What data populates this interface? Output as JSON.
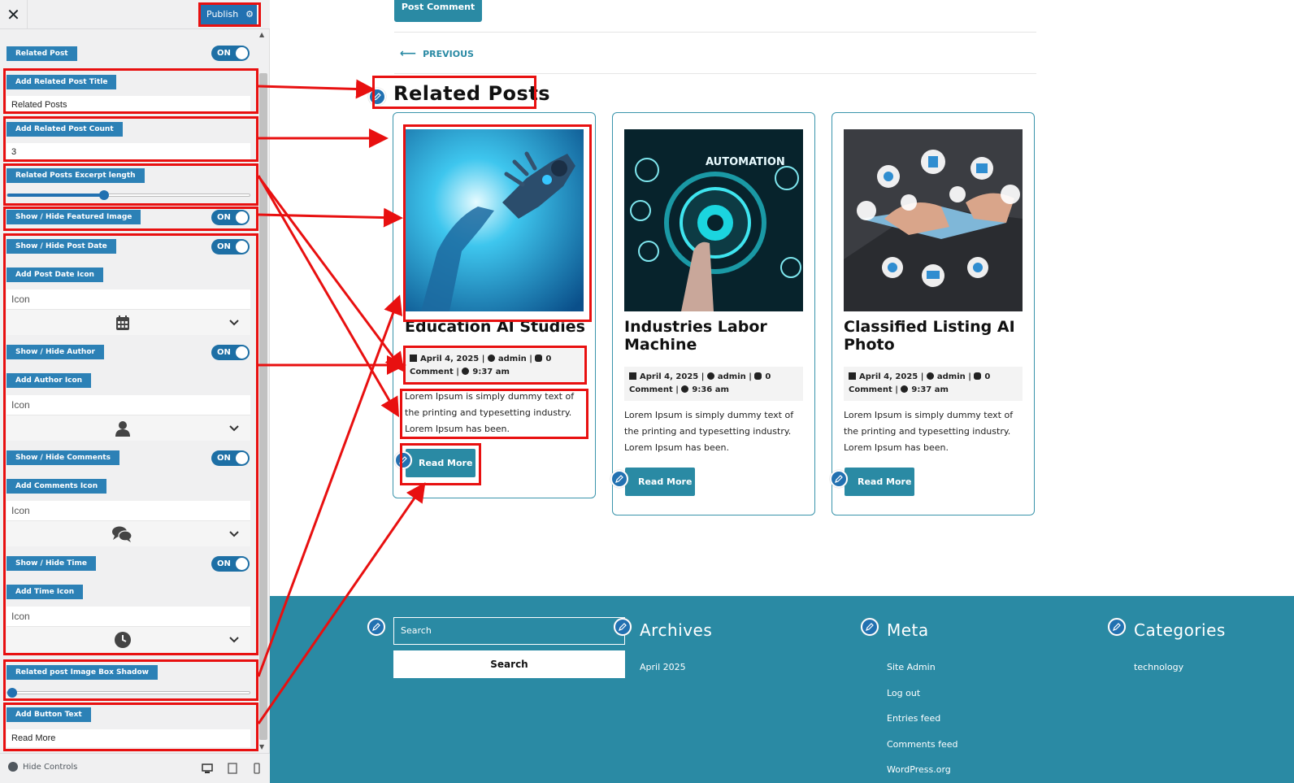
{
  "customizer": {
    "close_icon": "close-icon",
    "publish_label": "Publish",
    "hide_controls_label": "Hide Controls",
    "controls": {
      "related_post": {
        "label": "Related Post",
        "toggle": "ON"
      },
      "post_title": {
        "label": "Add Related Post Title",
        "value": "Related Posts"
      },
      "post_count": {
        "label": "Add Related Post Count",
        "value": "3"
      },
      "excerpt_length": {
        "label": "Related Posts Excerpt length",
        "value_fraction": 0.4
      },
      "featured_image": {
        "label": "Show / Hide Featured Image",
        "toggle": "ON"
      },
      "post_date": {
        "label": "Show / Hide Post Date",
        "toggle": "ON"
      },
      "date_icon": {
        "label": "Add Post Date Icon",
        "placeholder": "Icon",
        "selected_icon": "calendar-icon"
      },
      "author": {
        "label": "Show / Hide Author",
        "toggle": "ON"
      },
      "author_icon": {
        "label": "Add Author Icon",
        "placeholder": "Icon",
        "selected_icon": "user-icon"
      },
      "comments": {
        "label": "Show / Hide Comments",
        "toggle": "ON"
      },
      "comments_icon": {
        "label": "Add Comments Icon",
        "placeholder": "Icon",
        "selected_icon": "comments-icon"
      },
      "time": {
        "label": "Show / Hide Time",
        "toggle": "ON"
      },
      "time_icon": {
        "label": "Add Time Icon",
        "placeholder": "Icon",
        "selected_icon": "clock-icon"
      },
      "image_shadow": {
        "label": "Related post Image Box Shadow",
        "value_fraction": 0.0
      },
      "button_text": {
        "label": "Add Button Text",
        "value": "Read More"
      }
    }
  },
  "preview": {
    "post_comment_label": "Post Comment",
    "previous_label": "PREVIOUS",
    "related_title": "Related Posts",
    "cards": [
      {
        "title": "Education AI Studies",
        "date": "April 4, 2025",
        "author": "admin",
        "comments": "0",
        "comment_word": "Comment",
        "time": "9:37 am",
        "excerpt": "Lorem Ipsum is simply dummy text of the printing and typesetting industry. Lorem Ipsum has been.",
        "button": "Read More",
        "image": "robot-hand-image"
      },
      {
        "title": "Industries Labor Machine",
        "date": "April 4, 2025",
        "author": "admin",
        "comments": "0",
        "comment_word": "Comment",
        "time": "9:36 am",
        "excerpt": "Lorem Ipsum is simply dummy text of the printing and typesetting industry. Lorem Ipsum has been.",
        "button": "Read More",
        "image": "automation-image",
        "image_text": "AUTOMATION"
      },
      {
        "title": "Classified Listing AI Photo",
        "date": "April 4, 2025",
        "author": "admin",
        "comments": "0",
        "comment_word": "Comment",
        "time": "9:37 am",
        "excerpt": "Lorem Ipsum is simply dummy text of the printing and typesetting industry. Lorem Ipsum has been.",
        "button": "Read More",
        "image": "smart-devices-image"
      }
    ],
    "footer": {
      "search_placeholder": "Search",
      "search_button": "Search",
      "archives_title": "Archives",
      "archives": [
        "April 2025"
      ],
      "meta_title": "Meta",
      "meta_links": [
        "Site Admin",
        "Log out",
        "Entries feed",
        "Comments feed",
        "WordPress.org"
      ],
      "categories_title": "Categories",
      "categories": [
        "technology"
      ]
    }
  },
  "colors": {
    "annotation": "#e81010",
    "accent": "#2a8aa4",
    "wp_blue": "#2271b1"
  }
}
